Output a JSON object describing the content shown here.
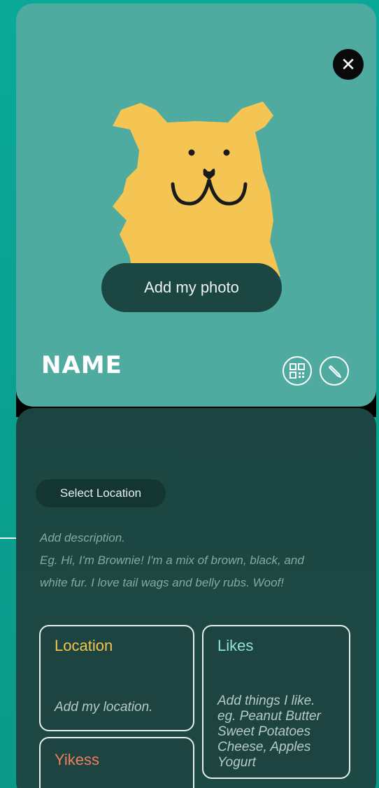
{
  "profile": {
    "name": "NAME",
    "add_photo_label": "Add my photo",
    "close_symbol": "✕"
  },
  "location_pill": "Select Location",
  "description": {
    "line1": "Add description.",
    "line2": "Eg. Hi, I'm Brownie! I'm a mix of brown, black, and",
    "line3": "white fur. I love tail wags and belly rubs. Woof!"
  },
  "tiles": {
    "location": {
      "title": "Location",
      "body": "Add my location."
    },
    "likes": {
      "title": "Likes",
      "lines": [
        "Add things I like.",
        "eg. Peanut Butter",
        "Sweet Potatoes",
        "Cheese, Apples",
        "Yogurt"
      ]
    },
    "yikes": {
      "title": "Yikess"
    }
  },
  "colors": {
    "background": "#0aa897",
    "top_card": "#4faa9f",
    "bottom_card": "#1c4541",
    "dog": "#f5c554",
    "location_title": "#f3c451",
    "likes_title": "#8fe3d3",
    "yikes_title": "#ef7f60"
  },
  "icons": [
    "close-icon",
    "dog-avatar-icon",
    "qr-code-icon",
    "pencil-icon"
  ]
}
